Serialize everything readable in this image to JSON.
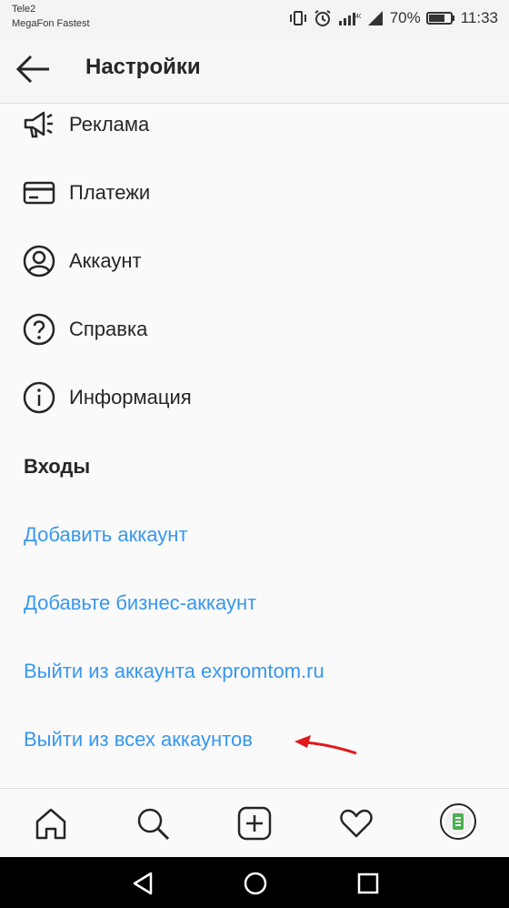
{
  "status_bar": {
    "carrier_1": "Tele2",
    "carrier_2": "MegaFon Fastest",
    "battery": "70%",
    "time": "11:33"
  },
  "header": {
    "title": "Настройки"
  },
  "menu": [
    {
      "label": "Реклама",
      "icon": "megaphone-icon"
    },
    {
      "label": "Платежи",
      "icon": "credit-card-icon"
    },
    {
      "label": "Аккаунт",
      "icon": "user-circle-icon"
    },
    {
      "label": "Справка",
      "icon": "help-circle-icon"
    },
    {
      "label": "Информация",
      "icon": "info-circle-icon"
    }
  ],
  "logins": {
    "title": "Входы",
    "links": [
      "Добавить аккаунт",
      "Добавьте бизнес-аккаунт",
      "Выйти из аккаунта expromtom.ru",
      "Выйти из всех аккаунтов"
    ]
  },
  "tabs": [
    "home-icon",
    "search-icon",
    "add-post-icon",
    "heart-icon",
    "profile-avatar"
  ],
  "colors": {
    "link": "#3897f0",
    "text": "#262626",
    "annotation_arrow": "#e0191c"
  }
}
